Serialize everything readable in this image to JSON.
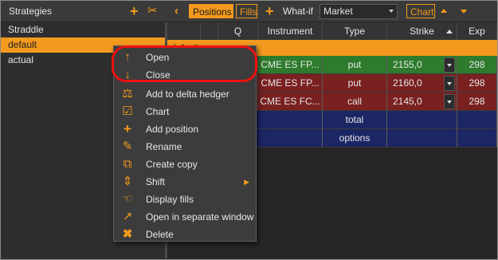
{
  "left_panel": {
    "title": "Strategies",
    "items": [
      {
        "label": "Straddle",
        "selected": false
      },
      {
        "label": "default",
        "selected": true
      },
      {
        "label": "actual",
        "selected": false
      }
    ]
  },
  "toolbar": {
    "positions_label": "Positions",
    "fills_label": "Fills",
    "whatif_label": "What-if",
    "market_value": "Market",
    "chart_label": "Chart"
  },
  "table": {
    "headers": [
      "Q",
      "Instrument",
      "Type",
      "Strike",
      "Exp"
    ],
    "group_label": "default",
    "rows": [
      {
        "instrument": "CME ES FP...",
        "type": "put",
        "strike": "2155,0",
        "exp": "298",
        "color": "#2e7b2d"
      },
      {
        "instrument": "CME ES FP...",
        "type": "put",
        "strike": "2160,0",
        "exp": "298",
        "color": "#7a2020"
      },
      {
        "instrument": "CME ES FC...",
        "type": "call",
        "strike": "2145,0",
        "exp": "298",
        "color": "#7a2020"
      }
    ],
    "summary_rows": [
      {
        "label": "total"
      },
      {
        "label": "options"
      }
    ]
  },
  "context_menu": {
    "items": [
      {
        "label": "Open",
        "icon": "arrow-up-icon"
      },
      {
        "label": "Close",
        "icon": "arrow-down-icon"
      },
      {
        "label": "Add to delta hedger",
        "icon": "delta-hedger-icon"
      },
      {
        "label": "Chart",
        "icon": "chart-icon"
      },
      {
        "label": "Add position",
        "icon": "plus-icon"
      },
      {
        "label": "Rename",
        "icon": "pencil-icon"
      },
      {
        "label": "Create copy",
        "icon": "copy-icon"
      },
      {
        "label": "Shift",
        "icon": "shift-icon",
        "submenu": true
      },
      {
        "label": "Display fills",
        "icon": "fills-icon"
      },
      {
        "label": "Open in separate window",
        "icon": "external-window-icon"
      },
      {
        "label": "Delete",
        "icon": "delete-icon"
      }
    ]
  },
  "colors": {
    "accent": "#f39a1e",
    "highlight_ring": "#e11111"
  }
}
